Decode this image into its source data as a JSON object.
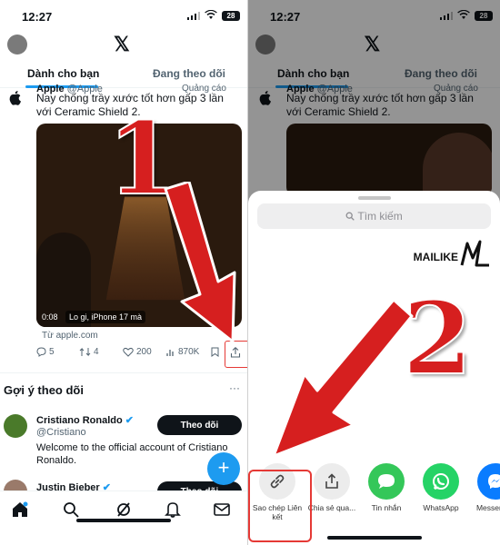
{
  "status": {
    "time": "12:27",
    "battery": "28"
  },
  "feed_tabs": {
    "for_you": "Dành cho bạn",
    "following": "Đang theo dõi"
  },
  "tweet": {
    "author": "Apple",
    "handle": "@Apple",
    "ad_label": "Quảng cáo",
    "text": "Nay chống trầy xước tốt hơn gấp 3 lần với Ceramic Shield 2.",
    "video_time": "0:08",
    "video_caption": "Lo gi, iPhone 17 mà",
    "from_site": "Từ apple.com",
    "replies": "5",
    "retweets": "4",
    "likes": "200",
    "views": "870K"
  },
  "suggestions": {
    "title": "Gợi ý theo dõi",
    "more": "···",
    "users": [
      {
        "name": "Cristiano Ronaldo",
        "handle": "@Cristiano",
        "bio": "Welcome to the official account of Cristiano Ronaldo.",
        "follow": "Theo dõi"
      },
      {
        "name": "Justin Bieber",
        "follow": "Theo dõi"
      }
    ]
  },
  "fab_label": "+",
  "annotations": {
    "step1": "1",
    "step2": "2"
  },
  "share_sheet": {
    "search_placeholder": "Tìm kiếm",
    "brand": "MAILIKE",
    "items": [
      {
        "label": "Sao chép Liên kết",
        "icon": "link-icon"
      },
      {
        "label": "Chia sẻ qua...",
        "icon": "share-icon"
      },
      {
        "label": "Tin nhắn",
        "icon": "messages-icon"
      },
      {
        "label": "WhatsApp",
        "icon": "whatsapp-icon"
      },
      {
        "label": "Messenger",
        "icon": "messenger-icon"
      }
    ]
  },
  "colors": {
    "accent": "#1d9bf0",
    "annotation_red": "#d61f1f",
    "messages_green": "#34c759",
    "whatsapp_green": "#25d366",
    "messenger_blue": "#0a7cff"
  }
}
